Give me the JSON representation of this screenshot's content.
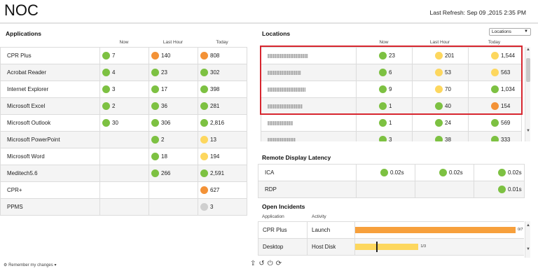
{
  "header": {
    "title": "NOC",
    "last_refresh": "Last Refresh: Sep 09 ,2015 2:35 PM"
  },
  "applications": {
    "title": "Applications",
    "columns": [
      "Now",
      "Last Hour",
      "Today"
    ],
    "rows": [
      {
        "name": "CPR Plus",
        "now": {
          "status": "green",
          "value": "7"
        },
        "hour": {
          "status": "orange",
          "value": "140"
        },
        "today": {
          "status": "orange",
          "value": "808"
        }
      },
      {
        "name": "Acrobat Reader",
        "now": {
          "status": "green",
          "value": "4"
        },
        "hour": {
          "status": "green",
          "value": "23"
        },
        "today": {
          "status": "green",
          "value": "302"
        }
      },
      {
        "name": "Internet Explorer",
        "now": {
          "status": "green",
          "value": "3"
        },
        "hour": {
          "status": "green",
          "value": "17"
        },
        "today": {
          "status": "green",
          "value": "398"
        }
      },
      {
        "name": "Microsoft Excel",
        "now": {
          "status": "green",
          "value": "2"
        },
        "hour": {
          "status": "green",
          "value": "36"
        },
        "today": {
          "status": "green",
          "value": "281"
        }
      },
      {
        "name": "Microsoft Outlook",
        "now": {
          "status": "green",
          "value": "30"
        },
        "hour": {
          "status": "green",
          "value": "306"
        },
        "today": {
          "status": "green",
          "value": "2,816"
        }
      },
      {
        "name": "Microsoft PowerPoint",
        "now": null,
        "hour": {
          "status": "green",
          "value": "2"
        },
        "today": {
          "status": "yellow",
          "value": "13"
        }
      },
      {
        "name": "Microsoft Word",
        "now": null,
        "hour": {
          "status": "green",
          "value": "18"
        },
        "today": {
          "status": "yellow",
          "value": "194"
        }
      },
      {
        "name": "Meditech5.6",
        "now": null,
        "hour": {
          "status": "green",
          "value": "266"
        },
        "today": {
          "status": "green",
          "value": "2,591"
        }
      },
      {
        "name": "CPR+",
        "now": null,
        "hour": null,
        "today": {
          "status": "orange",
          "value": "627"
        }
      },
      {
        "name": "PPMS",
        "now": null,
        "hour": null,
        "today": {
          "status": "gray",
          "value": "3"
        }
      }
    ]
  },
  "locations": {
    "title": "Locations",
    "dropdown_value": "Locations",
    "columns": [
      "Now",
      "Last Hour",
      "Today"
    ],
    "rows": [
      {
        "now": {
          "status": "green",
          "value": "23"
        },
        "hour": {
          "status": "yellow",
          "value": "201"
        },
        "today": {
          "status": "yellow",
          "value": "1,544"
        }
      },
      {
        "now": {
          "status": "green",
          "value": "6"
        },
        "hour": {
          "status": "yellow",
          "value": "53"
        },
        "today": {
          "status": "yellow",
          "value": "563"
        }
      },
      {
        "now": {
          "status": "green",
          "value": "9"
        },
        "hour": {
          "status": "yellow",
          "value": "70"
        },
        "today": {
          "status": "green",
          "value": "1,034"
        }
      },
      {
        "now": {
          "status": "green",
          "value": "1"
        },
        "hour": {
          "status": "green",
          "value": "40"
        },
        "today": {
          "status": "orange",
          "value": "154"
        }
      },
      {
        "now": {
          "status": "green",
          "value": "1"
        },
        "hour": {
          "status": "green",
          "value": "24"
        },
        "today": {
          "status": "green",
          "value": "569"
        }
      },
      {
        "now": {
          "status": "green",
          "value": "3"
        },
        "hour": {
          "status": "green",
          "value": "38"
        },
        "today": {
          "status": "green",
          "value": "333"
        }
      }
    ]
  },
  "latency": {
    "title": "Remote Display Latency",
    "rows": [
      {
        "name": "ICA",
        "now": {
          "status": "green",
          "value": "0.02s"
        },
        "hour": {
          "status": "green",
          "value": "0.02s"
        },
        "today": {
          "status": "green",
          "value": "0.02s"
        }
      },
      {
        "name": "RDP",
        "now": null,
        "hour": null,
        "today": {
          "status": "green",
          "value": "0.01s"
        }
      }
    ]
  },
  "incidents": {
    "title": "Open Incidents",
    "columns": [
      "Application",
      "Activity"
    ],
    "rows": [
      {
        "application": "CPR Plus",
        "activity": "Launch",
        "label": "0/7",
        "fill": 0.95,
        "color": "#f7a03c",
        "marker": null
      },
      {
        "application": "Desktop",
        "activity": "Host Disk",
        "label": "1/3",
        "fill": 0.375,
        "color": "#fdd75e",
        "marker": 0.125
      }
    ]
  },
  "footer": {
    "remember": "Remember my changes"
  }
}
